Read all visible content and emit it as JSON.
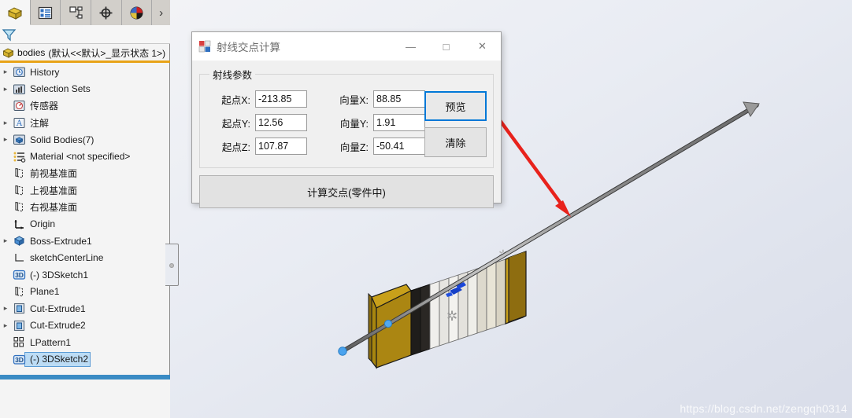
{
  "sidebar": {
    "tabs": [
      {
        "name": "feature-manager-tab",
        "icon": "feature-tree-icon",
        "active": true
      },
      {
        "name": "property-manager-tab",
        "icon": "property-list-icon",
        "active": false
      },
      {
        "name": "configuration-manager-tab",
        "icon": "configuration-icon",
        "active": false
      },
      {
        "name": "dimxpert-manager-tab",
        "icon": "crosshair-icon",
        "active": false
      },
      {
        "name": "display-manager-tab",
        "icon": "render-sphere-icon",
        "active": false
      }
    ],
    "chevron_label": "›",
    "filter_icon": "filter-funnel-icon",
    "root": {
      "icon": "part-body-icon",
      "label": "bodies",
      "config": "(默认<<默认>_显示状态 1>)"
    },
    "tree": [
      {
        "label": "History",
        "icon": "history-icon",
        "twist": true,
        "selected": false
      },
      {
        "label": "Selection Sets",
        "icon": "selection-sets-icon",
        "twist": true,
        "selected": false
      },
      {
        "label": "传感器",
        "icon": "sensor-icon",
        "twist": false,
        "selected": false
      },
      {
        "label": "注解",
        "icon": "annotations-icon",
        "twist": true,
        "selected": false
      },
      {
        "label": "Solid Bodies(7)",
        "icon": "solid-bodies-icon",
        "twist": true,
        "selected": false
      },
      {
        "label": "Material <not specified>",
        "icon": "material-icon",
        "twist": false,
        "selected": false
      },
      {
        "label": "前视基准面",
        "icon": "plane-icon",
        "twist": false,
        "selected": false
      },
      {
        "label": "上视基准面",
        "icon": "plane-icon",
        "twist": false,
        "selected": false
      },
      {
        "label": "右视基准面",
        "icon": "plane-icon",
        "twist": false,
        "selected": false
      },
      {
        "label": "Origin",
        "icon": "origin-icon",
        "twist": false,
        "selected": false
      },
      {
        "label": "Boss-Extrude1",
        "icon": "boss-extrude-icon",
        "twist": true,
        "selected": false
      },
      {
        "label": "sketchCenterLine",
        "icon": "sketch-icon",
        "twist": false,
        "selected": false
      },
      {
        "label": "(-) 3DSketch1",
        "icon": "3d-sketch-icon",
        "twist": false,
        "selected": false
      },
      {
        "label": "Plane1",
        "icon": "plane-icon",
        "twist": false,
        "selected": false
      },
      {
        "label": "Cut-Extrude1",
        "icon": "cut-extrude-icon",
        "twist": true,
        "selected": false
      },
      {
        "label": "Cut-Extrude2",
        "icon": "cut-extrude-icon",
        "twist": true,
        "selected": false
      },
      {
        "label": "LPattern1",
        "icon": "linear-pattern-icon",
        "twist": false,
        "selected": false
      },
      {
        "label": "(-) 3DSketch2",
        "icon": "3d-sketch-icon",
        "twist": false,
        "selected": true
      }
    ]
  },
  "dialog": {
    "title": "射线交点计算",
    "app_icon": "windows-form-icon",
    "minimize_label": "—",
    "maximize_label": "□",
    "close_label": "✕",
    "group_legend": "射线参数",
    "fields": [
      {
        "label": "起点X:",
        "value": "-213.85",
        "label2": "向量X:",
        "value2": "88.85"
      },
      {
        "label": "起点Y:",
        "value": "12.56",
        "label2": "向量Y:",
        "value2": "1.91"
      },
      {
        "label": "起点Z:",
        "value": "107.87",
        "label2": "向量Z:",
        "value2": "-50.41"
      }
    ],
    "preview_button": "预览",
    "clear_button": "清除",
    "compute_button": "计算交点(零件中)"
  },
  "viewport": {
    "watermark": "https://blog.csdn.net/zengqh0314",
    "annotation_arrow": "red-pointer-arrow",
    "ray_start_point": "ray-start-vertex",
    "ray_arrow_tip": "ray-direction-arrow",
    "model": "extruded-plate-stack-model"
  },
  "colors": {
    "accent_blue": "#0078d7",
    "selection_blue": "#3a8bc4",
    "root_rule": "#e8a317",
    "annotation_red": "#e8221c",
    "model_gold": "#b89013",
    "model_dark_gold": "#7d5f10"
  }
}
